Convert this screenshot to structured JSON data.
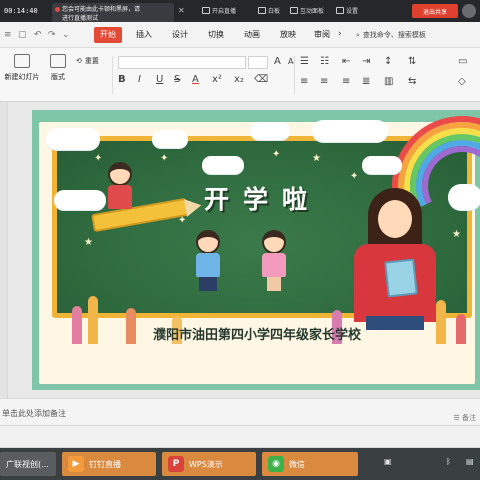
{
  "status_strip": {
    "time": "00:14:40",
    "notice_line1": "您会可能由此卡顿和黑屏，请",
    "notice_line2": "进行直播测试",
    "close_glyph": "✕",
    "tools": [
      "开启直播",
      "白板",
      "互动面板",
      "设置"
    ],
    "end_button": "退出共享"
  },
  "ribbon": {
    "tabs": [
      "开始",
      "插入",
      "设计",
      "切换",
      "动画",
      "放映",
      "审阅"
    ],
    "active_tab": "开始",
    "more_glyph": "›",
    "search_placeholder": "查找命令、搜索模板",
    "new_slide": "新建幻灯片",
    "layout": "版式",
    "reset": "重置",
    "bold": "B",
    "italic": "I",
    "underline": "U",
    "strike": "S",
    "font_color": "A"
  },
  "slide": {
    "title_art": "开学啦",
    "caption": "濮阳市油田第四小学四年级家长学校",
    "colors": {
      "board": "#2f6b3f",
      "frame": "#f0b437",
      "outer": "#7fc6a9"
    }
  },
  "notes": {
    "placeholder": "单击此处添加备注",
    "right_label": "备注"
  },
  "taskbar": {
    "items": [
      {
        "label": "广联视创(...",
        "icon": "browser-icon"
      },
      {
        "label": "钉钉直播",
        "icon": "dingtalk-icon"
      },
      {
        "label": "WPS演示",
        "icon": "wps-icon"
      },
      {
        "label": "微信",
        "icon": "wechat-icon"
      }
    ]
  }
}
